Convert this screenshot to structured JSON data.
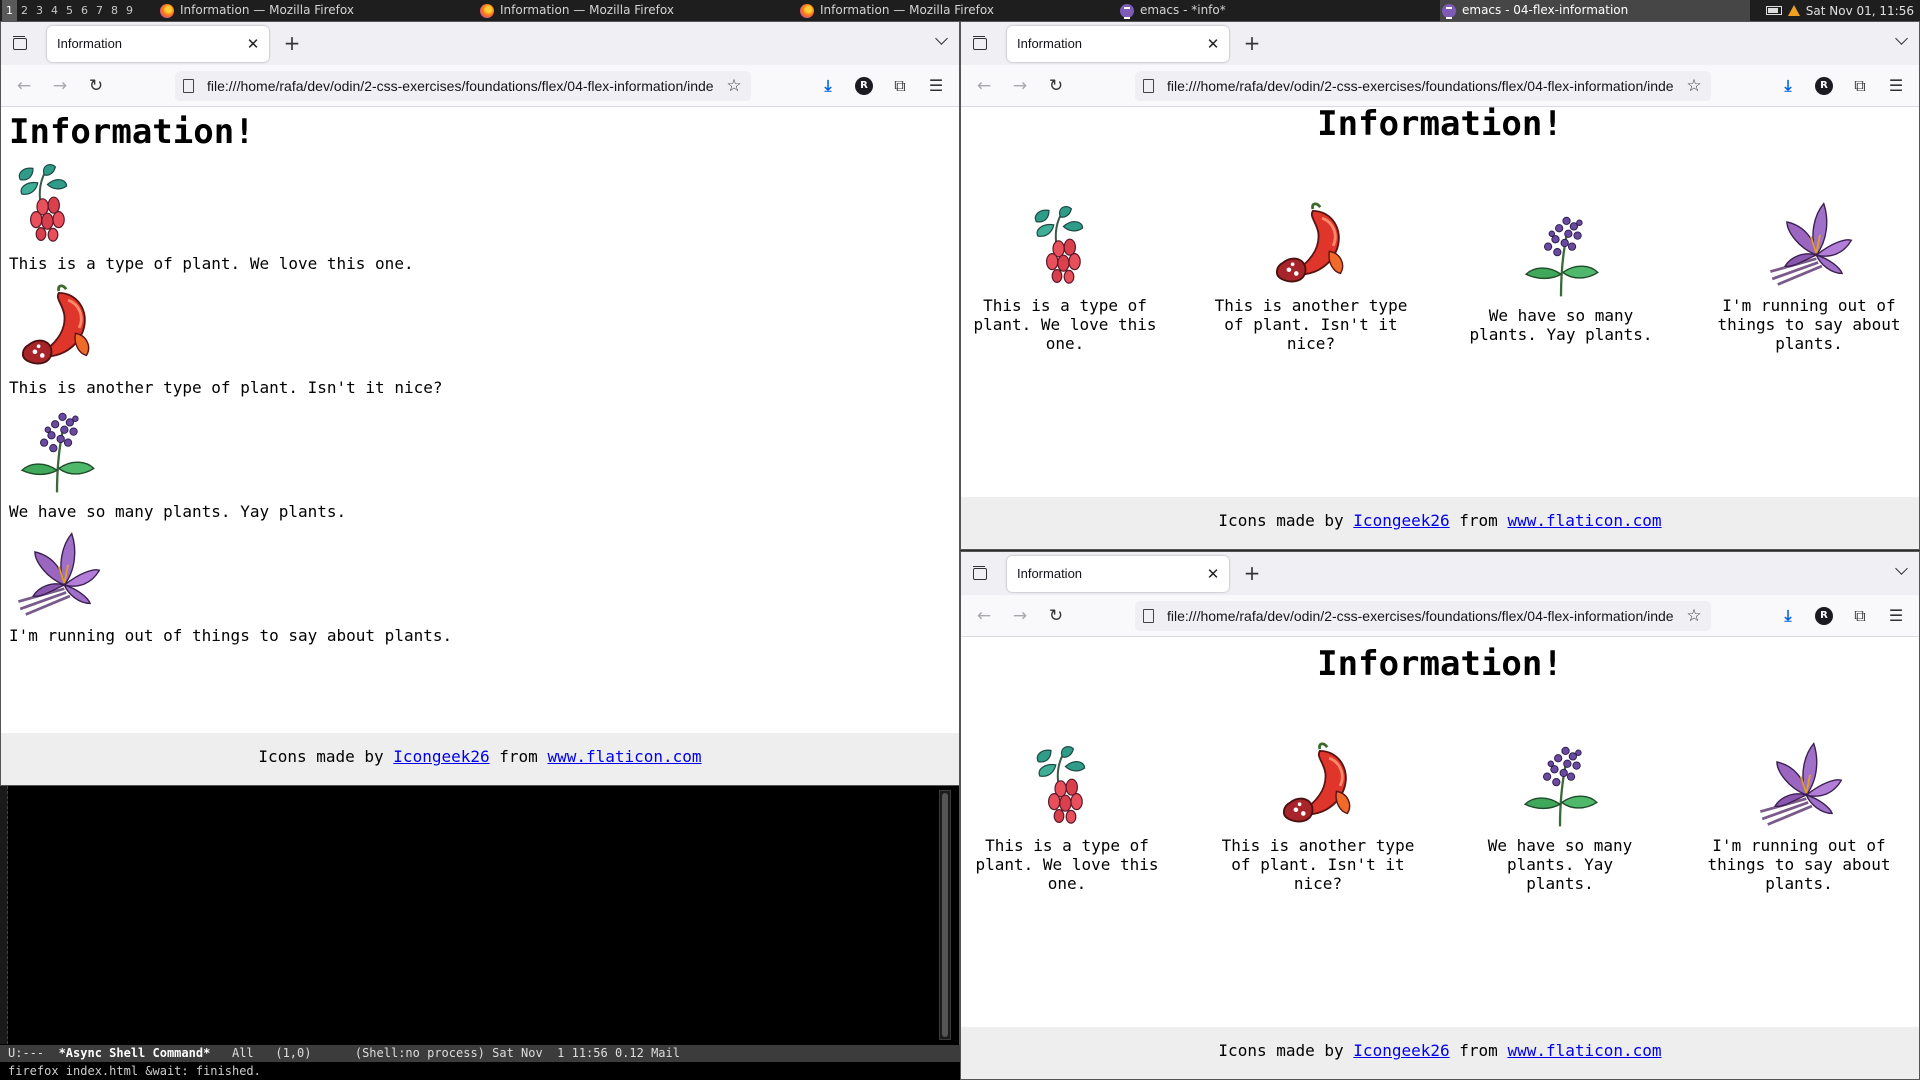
{
  "system_bar": {
    "workspaces": [
      "1",
      "2",
      "3",
      "4",
      "5",
      "6",
      "7",
      "8",
      "9"
    ],
    "active_workspace": "1",
    "tasks": [
      {
        "title": "Information — Mozilla Firefox",
        "icon": "firefox-icon"
      },
      {
        "title": "Information — Mozilla Firefox",
        "icon": "firefox-icon"
      },
      {
        "title": "Information — Mozilla Firefox",
        "icon": "firefox-icon"
      },
      {
        "title": "emacs - *info*",
        "icon": "emacs-icon"
      },
      {
        "title": "emacs - 04-flex-information",
        "icon": "emacs-icon"
      }
    ],
    "clock": "Sat Nov 01, 11:56"
  },
  "browser": {
    "tab_title": "Information",
    "url": "file:///home/rafa/dev/odin/2-css-exercises/foundations/flex/04-flex-information/index.html",
    "profile_initial": "R"
  },
  "page": {
    "heading": "Information!",
    "items": [
      {
        "text": "This is a type of plant. We love this one.",
        "image": "berries"
      },
      {
        "text": "This is another type of plant. Isn't it nice?",
        "image": "pepper"
      },
      {
        "text": "We have so many plants. Yay plants.",
        "image": "lilac"
      },
      {
        "text": "I'm running out of things to say about plants.",
        "image": "saffron"
      }
    ],
    "footer": {
      "prefix": "Icons made by",
      "author": "Icongeek26",
      "middle": "from",
      "site": "www.flaticon.com"
    }
  },
  "emacs": {
    "modeline": {
      "status": "U:---",
      "buffer": "*Async Shell Command*",
      "position": "All",
      "linecol": "(1,0)",
      "mode": "(Shell:no process)",
      "time": "Sat Nov  1 11:56 0.12 Mail"
    },
    "minibuffer": "firefox index.html &wait: finished."
  },
  "colors": {
    "link": "#0000ee",
    "footer_bg": "#eeeeee",
    "accent_download": "#0061e0"
  }
}
